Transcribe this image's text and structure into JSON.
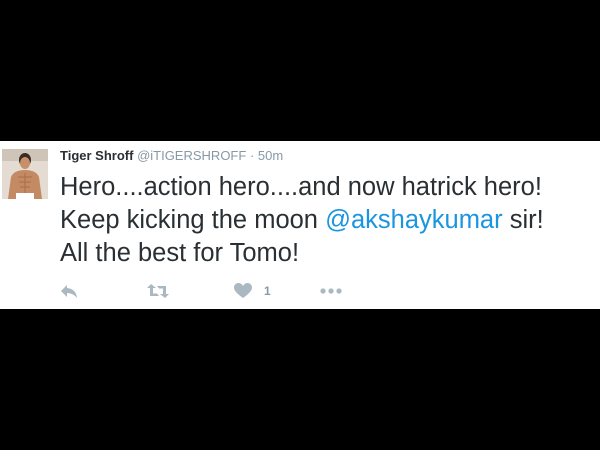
{
  "tweet": {
    "name": "Tiger Shroff",
    "handle": "@iTIGERSHROFF",
    "separator": "·",
    "time": "50m",
    "text": {
      "line1": "Hero....action hero....and now hatrick hero!",
      "line2_pre": "Keep kicking the moon ",
      "line2_mention": "@akshaykumar",
      "line2_post": " sir!",
      "line3": "All the best for Tomo!"
    },
    "actions": {
      "reply_icon": "reply-icon",
      "retweet_icon": "retweet-icon",
      "like_icon": "heart-icon",
      "like_count": "1",
      "more_icon": "more-icon"
    }
  },
  "colors": {
    "background": "#000000",
    "card": "#ffffff",
    "text": "#292f33",
    "muted": "#8899a6",
    "mention": "#1b95e0",
    "icon": "#aab8c2"
  }
}
